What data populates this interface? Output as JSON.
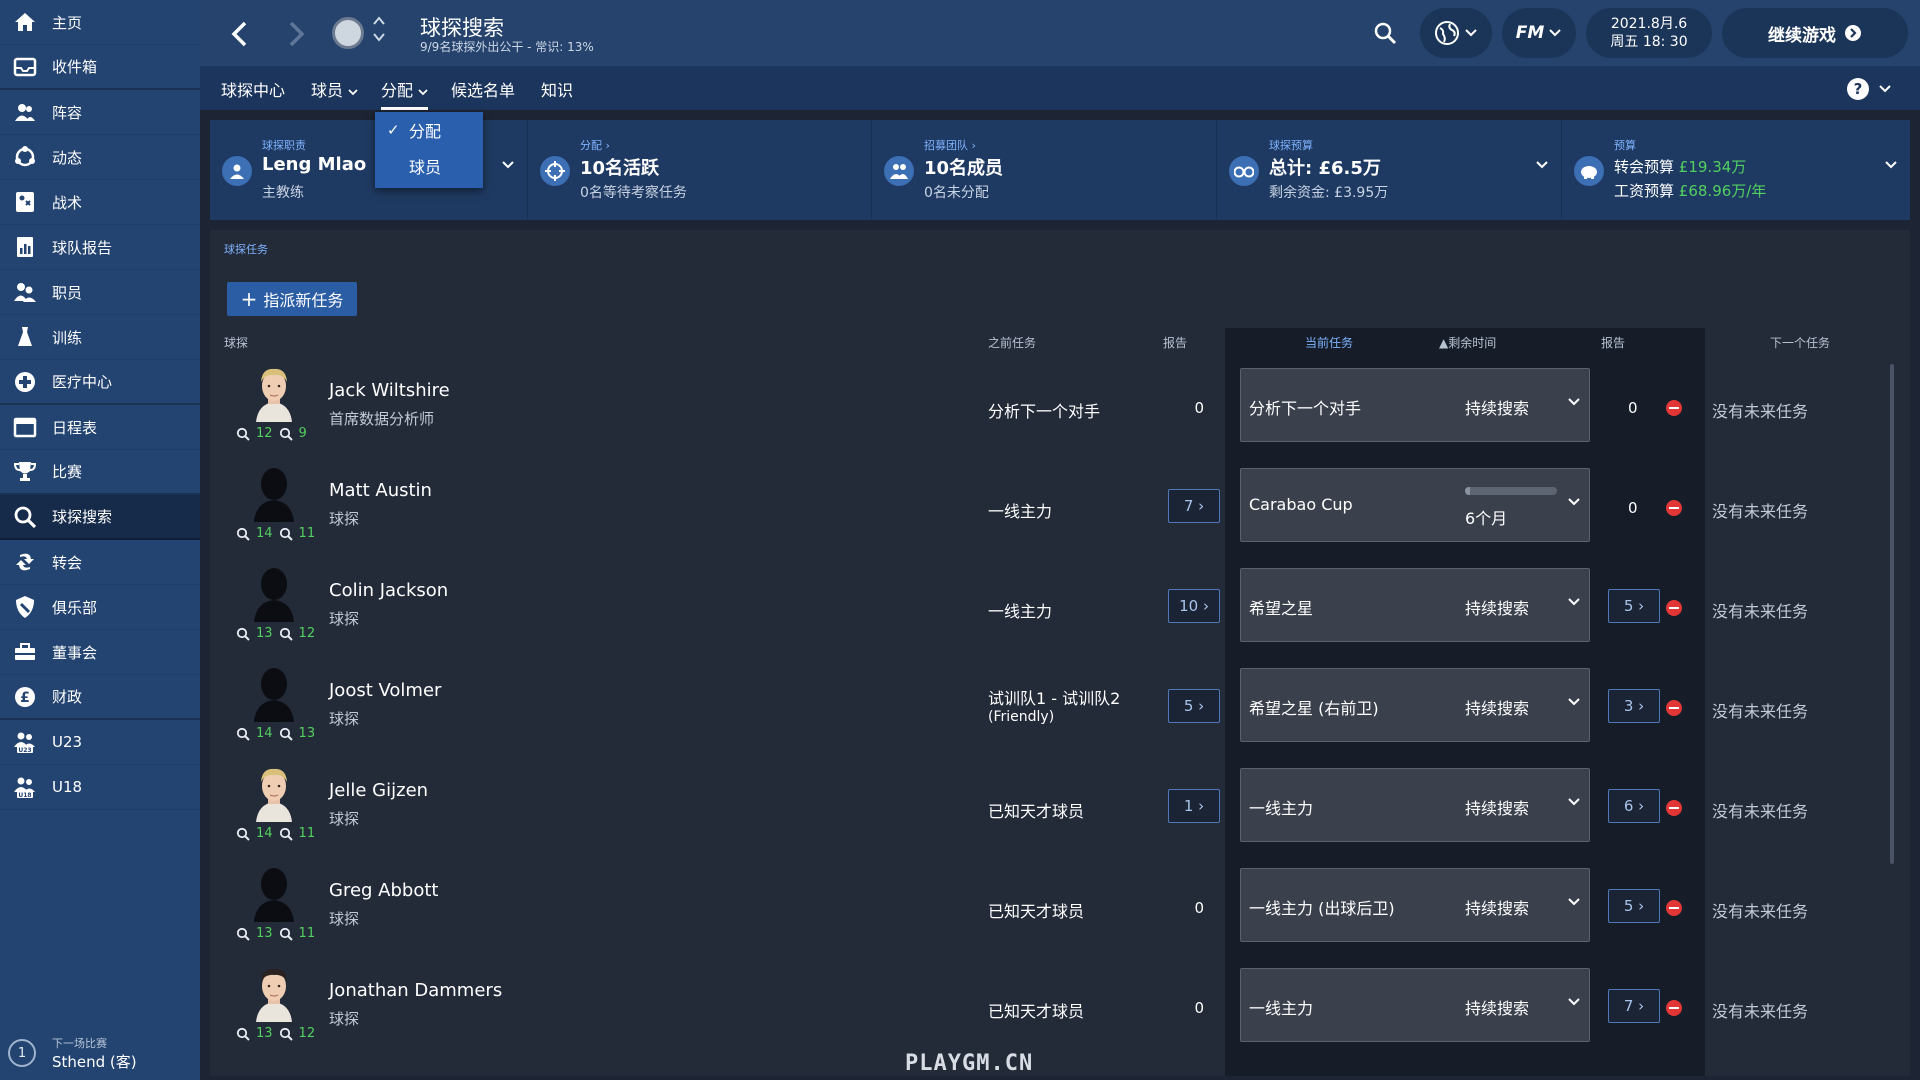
{
  "sidebar": {
    "items": [
      {
        "label": "主页",
        "icon": "home-icon"
      },
      {
        "label": "收件箱",
        "icon": "inbox-icon"
      },
      {
        "label": "阵容",
        "icon": "squad-icon"
      },
      {
        "label": "动态",
        "icon": "dynamics-icon"
      },
      {
        "label": "战术",
        "icon": "tactics-icon"
      },
      {
        "label": "球队报告",
        "icon": "report-icon"
      },
      {
        "label": "职员",
        "icon": "staff-icon"
      },
      {
        "label": "训练",
        "icon": "training-icon"
      },
      {
        "label": "医疗中心",
        "icon": "medical-icon"
      },
      {
        "label": "日程表",
        "icon": "calendar-icon"
      },
      {
        "label": "比赛",
        "icon": "trophy-icon"
      },
      {
        "label": "球探搜索",
        "icon": "search-icon"
      },
      {
        "label": "转会",
        "icon": "transfer-icon"
      },
      {
        "label": "俱乐部",
        "icon": "club-icon"
      },
      {
        "label": "董事会",
        "icon": "board-icon"
      },
      {
        "label": "财政",
        "icon": "finance-icon"
      },
      {
        "label": "U23",
        "icon": "u23-icon"
      },
      {
        "label": "U18",
        "icon": "u18-icon"
      }
    ],
    "active_index": 11,
    "next_match_number": "1",
    "next_match_label": "下一场比赛",
    "next_match_opponent": "Sthend (客)"
  },
  "header": {
    "title": "球探搜索",
    "subtitle": "9/9名球探外出公干 - 常识: 13%",
    "date": "2021.8月.6",
    "day_time": "周五 18: 30",
    "continue_label": "继续游戏",
    "fm_label": "FM"
  },
  "subnav": {
    "tabs": [
      "球探中心",
      "球员",
      "分配",
      "候选名单",
      "知识"
    ],
    "active_index": 2
  },
  "dropdown": {
    "options": [
      "分配",
      "球员"
    ],
    "selected_index": 0
  },
  "summary": {
    "scout": {
      "label": "球探职责",
      "name": "Leng Mlao",
      "role": "主教练"
    },
    "assign": {
      "label": "分配",
      "main": "10名活跃",
      "sub": "0名等待考察任务"
    },
    "team": {
      "label": "招募团队",
      "main": "10名成员",
      "sub": "0名未分配"
    },
    "budget": {
      "label": "球探预算",
      "main": "总计: £6.5万",
      "sub": "剩余资金: £3.95万"
    },
    "finance": {
      "label": "预算",
      "transfer_label": "转会预算",
      "transfer_value": "£19.34万",
      "wage_label": "工资预算",
      "wage_value": "£68.96万/年"
    }
  },
  "main": {
    "section_label": "球探任务",
    "assign_button": "指派新任务",
    "columns": {
      "scout": "球探",
      "prev_task": "之前任务",
      "reports": "报告",
      "current_task": "当前任务",
      "time_left": "▲剩余时间",
      "cur_reports": "报告",
      "next_task": "下一个任务"
    }
  },
  "scouts": [
    {
      "name": "Jack Wiltshire",
      "role": "首席数据分析师",
      "r1": "12",
      "r2": "9",
      "avatar": "blond",
      "prev_task": "分析下一个对手",
      "prev_task2": "",
      "prev_reports": "0",
      "cur_task": "分析下一个对手",
      "time": "持续搜索",
      "time_progress": null,
      "cur_reports": "0",
      "next_task": "没有未来任务"
    },
    {
      "name": "Matt Austin",
      "role": "球探",
      "r1": "14",
      "r2": "11",
      "avatar": "silhouette",
      "prev_task": "一线主力",
      "prev_task2": "",
      "prev_reports": "7",
      "cur_task": "Carabao Cup",
      "time": "6个月",
      "time_progress": 0.05,
      "cur_reports": "0",
      "next_task": "没有未来任务"
    },
    {
      "name": "Colin Jackson",
      "role": "球探",
      "r1": "13",
      "r2": "12",
      "avatar": "silhouette",
      "prev_task": "一线主力",
      "prev_task2": "",
      "prev_reports": "10",
      "cur_task": "希望之星",
      "time": "持续搜索",
      "time_progress": null,
      "cur_reports": "5",
      "next_task": "没有未来任务"
    },
    {
      "name": "Joost Volmer",
      "role": "球探",
      "r1": "14",
      "r2": "13",
      "avatar": "silhouette",
      "prev_task": "试训队1 - 试训队2",
      "prev_task2": "(Friendly)",
      "prev_reports": "5",
      "cur_task": "希望之星 (右前卫)",
      "time": "持续搜索",
      "time_progress": null,
      "cur_reports": "3",
      "next_task": "没有未来任务"
    },
    {
      "name": "Jelle Gijzen",
      "role": "球探",
      "r1": "14",
      "r2": "11",
      "avatar": "blond",
      "prev_task": "已知天才球员",
      "prev_task2": "",
      "prev_reports": "1",
      "cur_task": "一线主力",
      "time": "持续搜索",
      "time_progress": null,
      "cur_reports": "6",
      "next_task": "没有未来任务"
    },
    {
      "name": "Greg Abbott",
      "role": "球探",
      "r1": "13",
      "r2": "11",
      "avatar": "silhouette",
      "prev_task": "已知天才球员",
      "prev_task2": "",
      "prev_reports": "0",
      "cur_task": "一线主力 (出球后卫)",
      "time": "持续搜索",
      "time_progress": null,
      "cur_reports": "5",
      "next_task": "没有未来任务"
    },
    {
      "name": "Jonathan Dammers",
      "role": "球探",
      "r1": "13",
      "r2": "12",
      "avatar": "dark-hair",
      "prev_task": "已知天才球员",
      "prev_task2": "",
      "prev_reports": "0",
      "cur_task": "一线主力",
      "time": "持续搜索",
      "time_progress": null,
      "cur_reports": "7",
      "next_task": "没有未来任务"
    }
  ],
  "watermark": "PLAYGM.CN",
  "colors": {
    "accent": "#2b5da5",
    "sidebar": "#234370",
    "green": "#52d05f",
    "remove": "#e23636"
  }
}
